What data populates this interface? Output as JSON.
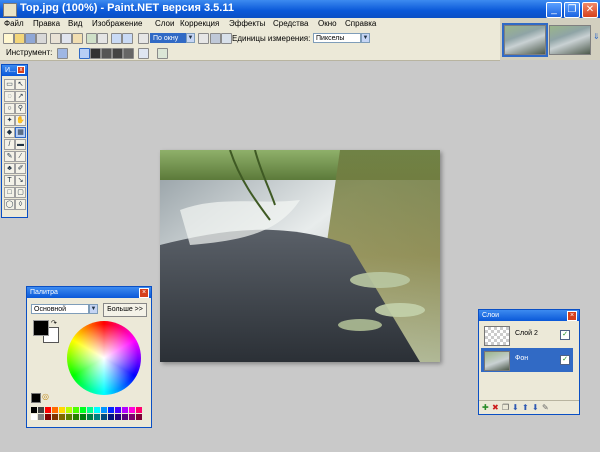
{
  "window": {
    "title": "Top.jpg (100%) - Paint.NET версия 3.5.11"
  },
  "menu": [
    "Файл",
    "Правка",
    "Вид",
    "Изображение",
    "Слои",
    "Коррекция",
    "Эффекты",
    "Средства",
    "Окно",
    "Справка"
  ],
  "toolbar": {
    "zoom_value": "По окну",
    "units_label": "Единицы измерения:",
    "units_value": "Пикселы",
    "tool_label": "Инструмент:"
  },
  "tools_window": {
    "title": "И..."
  },
  "palette": {
    "title": "Палитра",
    "mode_value": "Основной",
    "more_button": "Больше >>"
  },
  "layers": {
    "title": "Слои",
    "items": [
      {
        "name": "Слой 2",
        "visible_mark": "✓",
        "selected": false
      },
      {
        "name": "Фон",
        "visible_mark": "✓",
        "selected": true
      }
    ]
  },
  "colors": {
    "accent": "#0a58d8",
    "primary_color": "#000000",
    "secondary_color": "#ffffff",
    "workspace": "#c9c9c9",
    "chrome": "#ece9d8",
    "selection": "#316ac5"
  },
  "icons": [
    "app-icon",
    "minimize-icon",
    "maximize-icon",
    "close-icon",
    "new-icon",
    "open-icon",
    "save-icon",
    "print-icon",
    "cut-icon",
    "copy-icon",
    "paste-icon",
    "crop-icon",
    "deselect-icon",
    "undo-icon",
    "redo-icon",
    "zoom-icon",
    "grid-icon",
    "antialias-icon",
    "blend-mode-icon",
    "color-wheel-icon",
    "add-layer-icon",
    "delete-layer-icon",
    "layer-properties-icon"
  ]
}
